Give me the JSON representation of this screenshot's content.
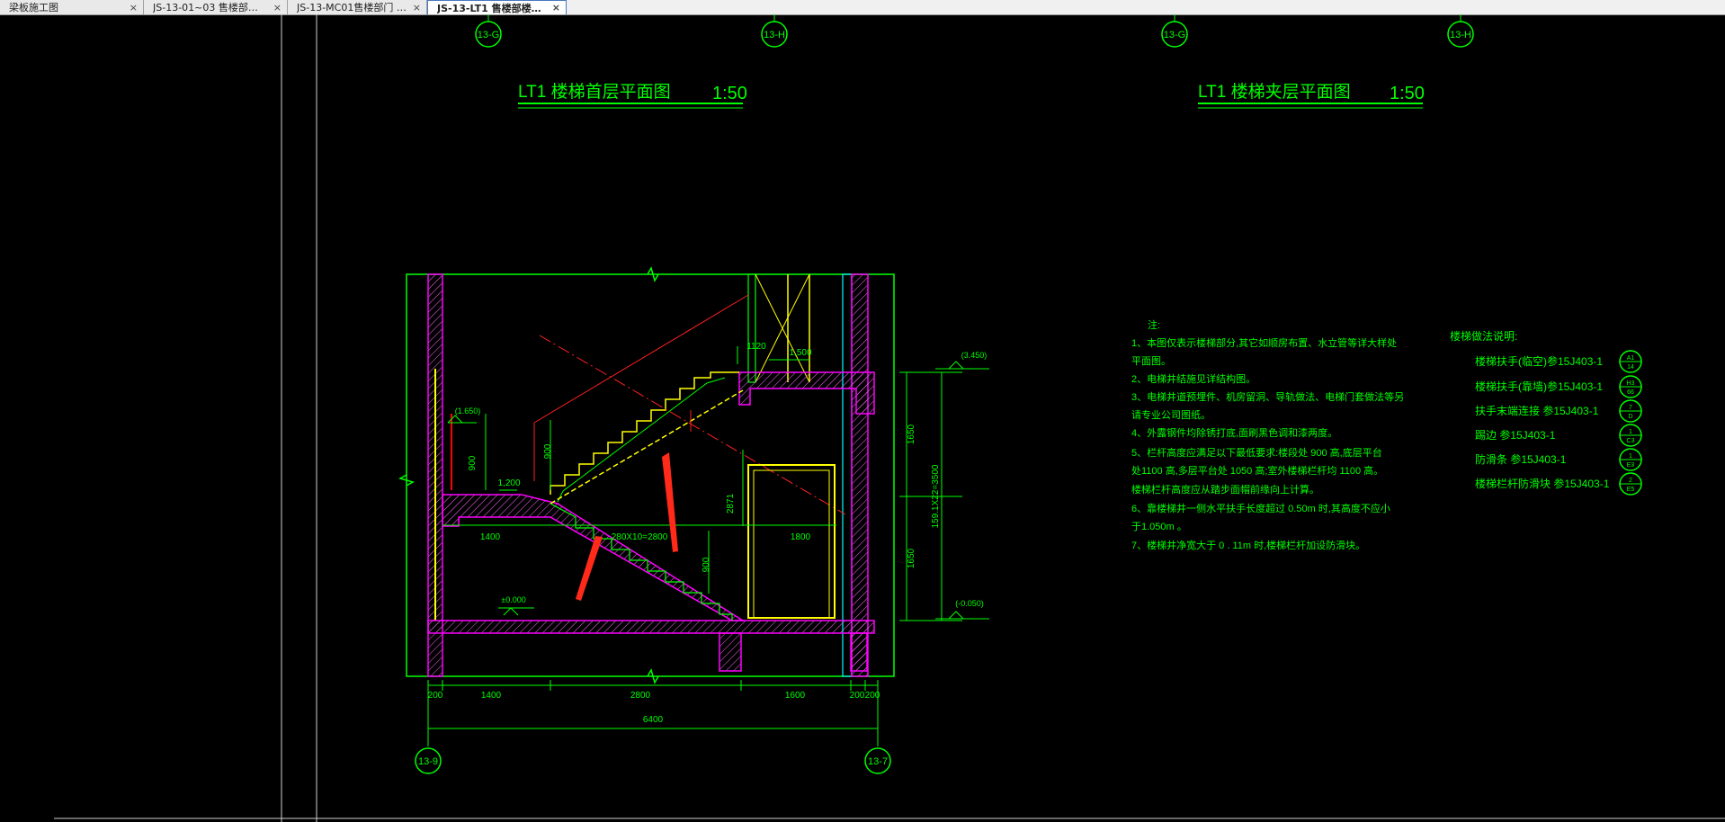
{
  "tabs": [
    {
      "label": "梁板施工图",
      "close": "×"
    },
    {
      "label": "JS-13-01~03 售楼部…",
      "close": "×"
    },
    {
      "label": "JS-13-MC01售楼部门 j…",
      "close": "×"
    },
    {
      "label": "JS-13-LT1 售楼部楼…",
      "close": "×",
      "active": true
    }
  ],
  "drawing": {
    "left_plan": {
      "title": "LT1  楼梯首层平面图",
      "scale": "1:50"
    },
    "right_plan": {
      "title": "LT1  楼梯夹层平面图",
      "scale": "1:50"
    },
    "axis_tags": {
      "top": [
        "13-G",
        "13-H",
        "13-G",
        "13-H"
      ],
      "bottom": [
        "13-9",
        "13-7"
      ]
    },
    "dims": {
      "bottom_segments": [
        "200",
        "1400",
        "2800",
        "1600",
        "200",
        "200"
      ],
      "bottom_total": "6400",
      "right_vertical": [
        "1650",
        "1650"
      ],
      "right_total": "159.1X22=3500",
      "interior": {
        "landing_width": "1400",
        "steps": "280X10=2800",
        "void_width": "1800",
        "h900_a": "900",
        "h900_b": "900",
        "h900_c": "900",
        "h1200": "1,200",
        "h1120": "1120",
        "h1500": "1,500",
        "h2871": "2871"
      },
      "levels": [
        "(1.650)",
        "(3.450)",
        "(-0.050)",
        "±0.000"
      ]
    },
    "notes": {
      "header": "注:",
      "lines": [
        "1、本图仅表示楼梯部分,其它如顺房布置、水立管等详大样处",
        "   平面图。",
        "2、电梯井结施见详结构图。",
        "3、电梯井道预埋件、机房留洞、导轨做法、电梯门套做法等另",
        "   请专业公司图纸。",
        "4、外露钢件均除锈打底,面刷黑色调和漆两度。",
        "5、栏杆高度应满足以下最低要求:楼段处          900    高,底层平台",
        "   处1100    高,多层平台处       1050    高;室外楼梯栏杆均       1100    高。",
        "   楼梯栏杆高度应从踏步面帽前缘向上计算。",
        "6、靠楼梯井一侧水平扶手长度超过         0.50m    时,其高度不应小",
        "   于1.050m     。",
        "7、楼梯井净宽大于      0 . 11m  时,楼梯栏杆加设防滑块。"
      ]
    },
    "legend": {
      "header": "楼梯做法说明:",
      "rows": [
        {
          "label": "楼梯扶手(临空)参15J403-1",
          "ref_top": "A1",
          "ref_bottom": "14"
        },
        {
          "label": "楼梯扶手(靠墙)参15J403-1",
          "ref_top": "H3",
          "ref_bottom": "66"
        },
        {
          "label": "扶手末端连接    参15J403-1",
          "ref_top": "7",
          "ref_bottom": "D"
        },
        {
          "label": "踢边              参15J403-1",
          "ref_top": "1",
          "ref_bottom": "C3"
        },
        {
          "label": "防滑条            参15J403-1",
          "ref_top": "1",
          "ref_bottom": "E3"
        },
        {
          "label": "楼梯栏杆防滑块  参15J403-1",
          "ref_top": "2",
          "ref_bottom": "E5"
        }
      ]
    }
  },
  "colors": {
    "bg": "#000000",
    "line": "#00ff00",
    "wall": "#ff00ff",
    "hatch": "#ff66ff",
    "cut": "#ff2020",
    "stair": "#ffff00",
    "tag": "#00ff00",
    "arrow": "#ff2a1a",
    "text": "#00ff00"
  }
}
